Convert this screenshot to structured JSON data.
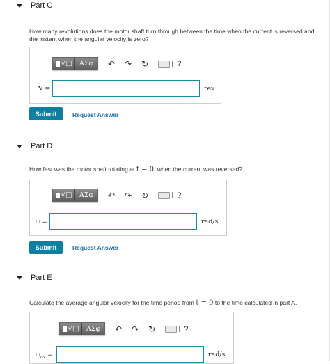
{
  "part_c": {
    "title": "Part C",
    "question_line1": "How many revolutions does the motor shaft turn through between the time when the current is reversed and",
    "question_line2": "the instant when the angular velocity is zero?",
    "var_label": "N =",
    "unit": "rev",
    "input_value": "",
    "submit_label": "Submit",
    "request_answer_label": "Request Answer"
  },
  "part_d": {
    "title": "Part D",
    "question_prefix": "How fast was the motor shaft rotating at ",
    "question_math": "t = 0",
    "question_suffix": ", when the current was reversed?",
    "var_label": "ω =",
    "unit": "rad/s",
    "input_value": "",
    "submit_label": "Submit",
    "request_answer_label": "Request Answer"
  },
  "part_e": {
    "title": "Part E",
    "question_prefix": "Calculate the average angular velocity for the time period from ",
    "question_math": "t = 0",
    "question_suffix": " to the time calculated in part A.",
    "var_label": "ω",
    "var_subscript": "av",
    "var_eq": " =",
    "unit": "rad/s",
    "input_value": ""
  },
  "toolbar": {
    "templates_label": "√□",
    "greek_label": "ΑΣφ",
    "undo_icon": "undo-icon",
    "redo_icon": "redo-icon",
    "reset_icon": "reset-icon",
    "keyboard_icon": "keyboard-icon",
    "help_label": "?"
  }
}
